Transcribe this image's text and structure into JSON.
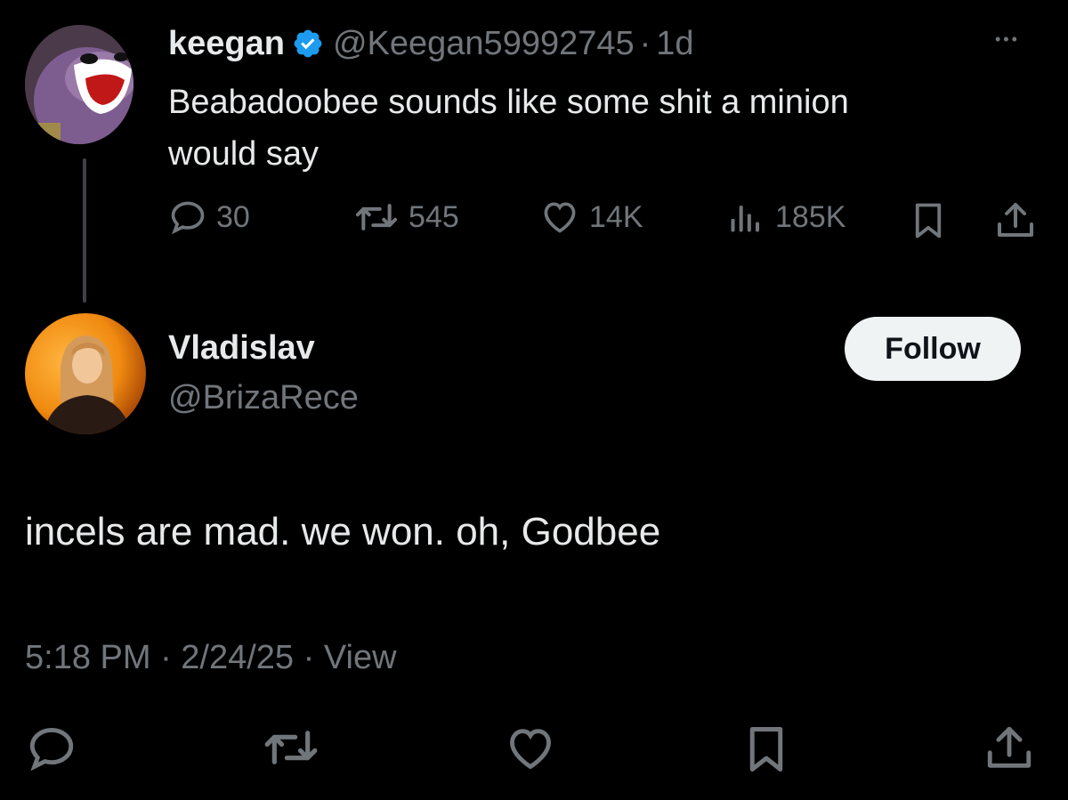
{
  "parent_tweet": {
    "display_name": "keegan",
    "handle": "@Keegan59992745",
    "time_sep": "·",
    "time": "1d",
    "text_line1": "Beabadoobee sounds like some shit a minion",
    "text_line2": "would say",
    "more_glyph": "•••",
    "stats": {
      "replies": "30",
      "reposts": "545",
      "likes": "14K",
      "views": "185K"
    },
    "verified_color": "#1d9bf0"
  },
  "reply_tweet": {
    "display_name": "Vladislav",
    "handle": "@BrizaRece",
    "follow_label": "Follow",
    "text": "incels are mad. we won. oh, Godbee",
    "timestamp": "5:18 PM · 2/24/25 · View"
  },
  "colors": {
    "background": "#000000",
    "text": "#e7e9ea",
    "muted": "#71767b",
    "follow_bg": "#eff3f4"
  }
}
